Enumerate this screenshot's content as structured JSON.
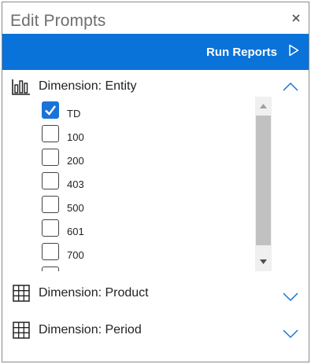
{
  "dialog": {
    "title": "Edit Prompts",
    "close_icon": "close-icon"
  },
  "toolbar": {
    "run_label": "Run Reports",
    "run_icon": "play-outline-icon",
    "background_color": "#0a73d9"
  },
  "sections": [
    {
      "label": "Dimension: Entity",
      "icon": "bar-chart-icon",
      "expanded": true,
      "options": [
        {
          "label": "TD",
          "checked": true
        },
        {
          "label": "100",
          "checked": false
        },
        {
          "label": "200",
          "checked": false
        },
        {
          "label": "403",
          "checked": false
        },
        {
          "label": "500",
          "checked": false
        },
        {
          "label": "601",
          "checked": false
        },
        {
          "label": "700",
          "checked": false
        },
        {
          "label": "",
          "checked": false
        }
      ]
    },
    {
      "label": "Dimension: Product",
      "icon": "grid-icon",
      "expanded": false
    },
    {
      "label": "Dimension: Period",
      "icon": "grid-icon",
      "expanded": false
    }
  ],
  "colors": {
    "accent": "#1a73d8",
    "chevron": "#1a73d8",
    "title_text": "#6e6e6e"
  }
}
